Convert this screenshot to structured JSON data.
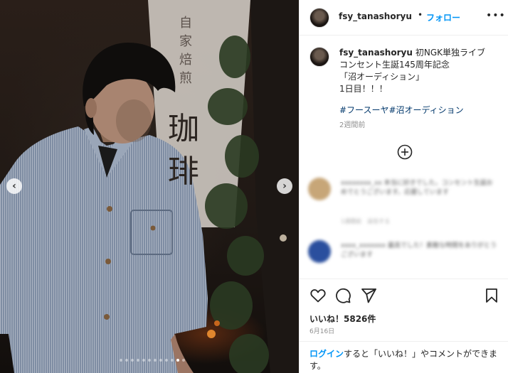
{
  "post": {
    "username": "fsy_tanashoryu",
    "separator": "•",
    "follow_label": "フォロー",
    "more_icon": "more-horizontal-icon",
    "caption_lines": [
      "初NGK単独ライブ",
      "コンセント生誕145周年記念",
      "「沼オーディション」",
      "1日目！！！"
    ],
    "hashtags": "#フースーヤ#沼オーディション",
    "age": "2週間前",
    "likes": "いいね！5826件",
    "date": "6月16日",
    "login_link": "ログイン",
    "login_rest": "すると「いいね！」やコメントができます。"
  },
  "photo": {
    "sign_chars": [
      "自",
      "家",
      "焙",
      "煎",
      "珈",
      "琲"
    ],
    "carousel_dot_count": 12,
    "carousel_active_index": 10
  },
  "comments": [
    {
      "text": "xxxxxxxx_xx 本当に好きでした。コンセント生誕おめでとうございます。応援しています",
      "meta": "1週間前　返信する"
    },
    {
      "text": "xxxx_xxxxxxx 最高でした！素敵な時間をありがとうございます",
      "meta": ""
    }
  ],
  "colors": {
    "link": "#0095f6",
    "hashtag": "#00376b",
    "muted": "#8e8e8e"
  }
}
